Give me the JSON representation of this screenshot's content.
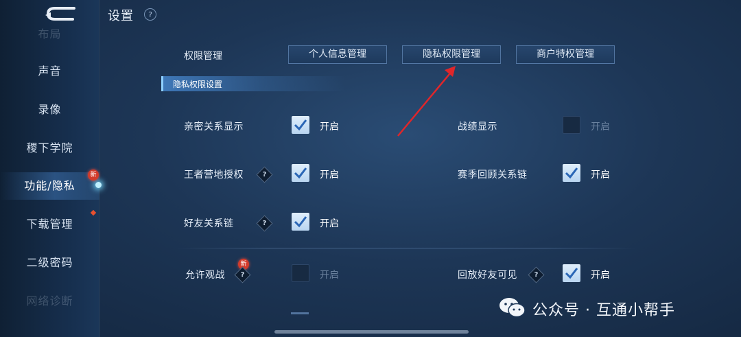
{
  "sidebar": {
    "items": [
      {
        "label": "布局",
        "faded": true
      },
      {
        "label": "声音"
      },
      {
        "label": "录像"
      },
      {
        "label": "稷下学院"
      },
      {
        "label": "功能/隐私",
        "active": true,
        "badge": "新"
      },
      {
        "label": "下载管理",
        "dot": true
      },
      {
        "label": "二级密码"
      },
      {
        "label": "网络诊断",
        "faded": true
      }
    ]
  },
  "header": {
    "title": "设置",
    "help_icon": "?"
  },
  "permissions": {
    "label": "权限管理",
    "tabs": [
      {
        "label": "个人信息管理"
      },
      {
        "label": "隐私权限管理",
        "selected": true
      },
      {
        "label": "商户特权管理"
      }
    ]
  },
  "section": {
    "title": "隐私权限设置"
  },
  "settings": [
    {
      "label": "亲密关系显示",
      "state": "开启",
      "checked": true
    },
    {
      "label": "战绩显示",
      "state": "开启",
      "checked": false
    },
    {
      "label": "王者营地授权",
      "state": "开启",
      "checked": true,
      "help": "?"
    },
    {
      "label": "赛季回顾关系链",
      "state": "开启",
      "checked": true
    },
    {
      "label": "好友关系链",
      "state": "开启",
      "checked": true,
      "help": "?"
    },
    {
      "label": "允许观战",
      "state": "开启",
      "checked": false,
      "help": "?",
      "badge": "新"
    },
    {
      "label": "回放好友可见",
      "state": "开启",
      "checked": true,
      "help": "?"
    }
  ],
  "watermark": {
    "text": "公众号 · 互通小帮手",
    "icon": "wechat-icon"
  },
  "colors": {
    "accent": "#8fd0ff",
    "badge": "#d23b2b",
    "arrow": "#e0262a"
  }
}
